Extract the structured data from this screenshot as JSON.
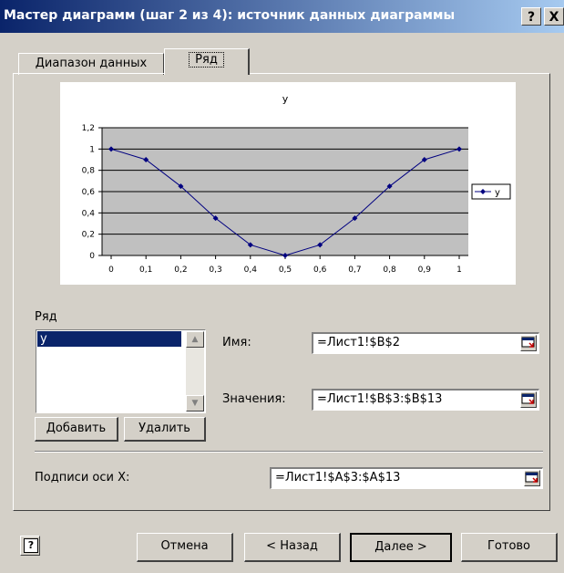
{
  "window": {
    "title": "Мастер диаграмм (шаг 2 из 4): источник данных диаграммы",
    "help_btn": "?",
    "close_btn": "X"
  },
  "tabs": [
    {
      "label": "Диапазон данных"
    },
    {
      "label": "Ряд"
    }
  ],
  "chart_data": {
    "type": "line",
    "title": "y",
    "x": [
      "0",
      "0,1",
      "0,2",
      "0,3",
      "0,4",
      "0,5",
      "0,6",
      "0,7",
      "0,8",
      "0,9",
      "1"
    ],
    "series": [
      {
        "name": "y",
        "values": [
          1,
          0.9,
          0.65,
          0.35,
          0.1,
          0,
          0.1,
          0.35,
          0.65,
          0.9,
          1
        ]
      }
    ],
    "ylim": [
      0,
      1.2
    ],
    "yticks": [
      "0",
      "0,2",
      "0,4",
      "0,6",
      "0,8",
      "1",
      "1,2"
    ],
    "grid": true,
    "legend": "right",
    "colors": {
      "line": "#000080",
      "plot_area": "#c0c0c0"
    }
  },
  "series_panel": {
    "label": "Ряд",
    "items": [
      "y"
    ],
    "add_button": "Добавить",
    "remove_button": "Удалить"
  },
  "fields": {
    "name_label": "Имя:",
    "name_value": "=Лист1!$B$2",
    "values_label": "Значения:",
    "values_value": "=Лист1!$B$3:$B$13",
    "xlabels_label": "Подписи оси X:",
    "xlabels_value": "=Лист1!$A$3:$A$13"
  },
  "buttons": {
    "cancel": "Отмена",
    "back": "< Назад",
    "next": "Далее >",
    "finish": "Готово"
  }
}
